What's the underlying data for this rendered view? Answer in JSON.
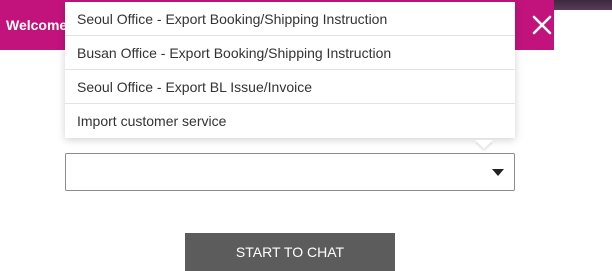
{
  "header": {
    "title": "Welcome",
    "close_icon": "close-icon",
    "background_color": "#c2137d"
  },
  "dropdown": {
    "options": [
      "Seoul Office - Export Booking/Shipping Instruction",
      "Busan Office - Export Booking/Shipping Instruction",
      "Seoul Office - Export BL Issue/Invoice",
      "Import customer service"
    ],
    "selected_value": "",
    "arrow_icon": "chevron-down-icon"
  },
  "start_button": {
    "label": "START TO CHAT",
    "color": "#5c5c5c"
  }
}
